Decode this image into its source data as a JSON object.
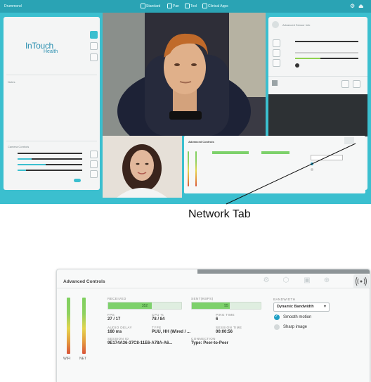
{
  "top_app": {
    "window_title": "Drummond",
    "toolbar": [
      {
        "label": "Standard"
      },
      {
        "label": "Pan"
      },
      {
        "label": "Tool"
      },
      {
        "label": "Clinical Apps"
      }
    ],
    "logo_text": "InTouch",
    "logo_sub": "Health",
    "right_panel_title": "Advanced Sensor Info",
    "left_section_label": "Notes",
    "camera_controls_label": "Camera Controls"
  },
  "callout": {
    "label": "Network Tab"
  },
  "advanced_controls": {
    "title": "Advanced Controls",
    "meters": {
      "wifi_label": "WIFI",
      "net_label": "NET"
    },
    "received": {
      "label": "RECEIVED",
      "value": "352",
      "fill_fraction": 0.6
    },
    "sent": {
      "label": "SENT(KBPS)",
      "value": "55",
      "fill_fraction": 0.55
    },
    "stats": [
      {
        "label": "FPS",
        "value": "27 / 17"
      },
      {
        "label": "CPU %",
        "value": "78 / 84"
      },
      {
        "label": "PING TIME",
        "value": "6"
      },
      {
        "label": "AUDIO DELAY",
        "value": "160 ms"
      },
      {
        "label": "TYPE",
        "value": "PUU, HH (Wired / ..."
      },
      {
        "label": "SESSION TIME",
        "value": "00:00:56"
      },
      {
        "label": "SESSION ID",
        "value": "9E174A36-37C8-11E6-A78A-A6..."
      },
      {
        "label": "CONNECTION",
        "value": "Type: Peer-to-Peer"
      }
    ],
    "bandwidth": {
      "label": "BANDWIDTH",
      "selected": "Dynamic Bandwidth",
      "options": [
        {
          "label": "Smooth motion",
          "checked": true
        },
        {
          "label": "Sharp image",
          "checked": false
        }
      ]
    },
    "tabs": [
      {
        "icon": "robot-icon"
      },
      {
        "icon": "drive-icon"
      },
      {
        "icon": "camera-icon"
      },
      {
        "icon": "settings-icon"
      },
      {
        "icon": "network-icon"
      }
    ]
  },
  "colors": {
    "accent": "#3bbfcf",
    "bar_green": "#7dd16b",
    "check_blue": "#1e9fc4"
  }
}
